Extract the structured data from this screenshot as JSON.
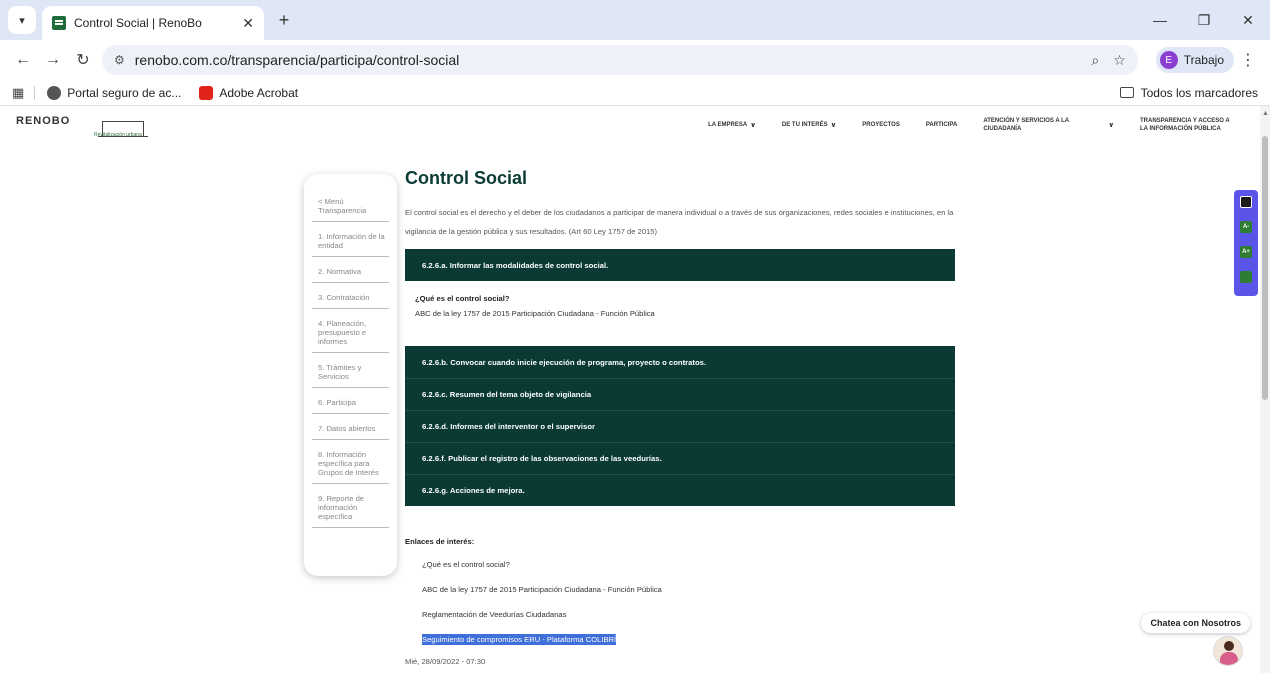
{
  "browser": {
    "tab_title": "Control Social | RenoBo",
    "tab_close": "✕",
    "new_tab": "+",
    "url": "renobo.com.co/transparencia/participa/control-social",
    "profile_initial": "E",
    "profile_name": "Trabajo",
    "bookmarks": [
      {
        "label": "Portal seguro de ac..."
      },
      {
        "label": "Adobe Acrobat"
      }
    ],
    "all_bookmarks": "Todos los marcadores"
  },
  "site": {
    "logo_text": "RENOBO",
    "logo_sub": "Revitalización urbana",
    "nav": [
      {
        "label": "LA EMPRESA",
        "chevron": "∨"
      },
      {
        "label": "DE TU INTERÉS",
        "chevron": "∨"
      },
      {
        "label": "PROYECTOS",
        "chevron": ""
      },
      {
        "label": "PARTICIPA",
        "chevron": ""
      },
      {
        "label": "ATENCIÓN Y SERVICIOS A LA CIUDADANÍA",
        "chevron": "∨"
      },
      {
        "label": "TRANSPARENCIA Y ACCESO A LA INFORMACIÓN PÚBLICA",
        "chevron": ""
      }
    ]
  },
  "sidemenu": [
    "< Menú Transparencia",
    "1. Información de la entidad",
    "2. Normativa",
    "3. Contratación",
    "4. Planeación, presupuesto e informes",
    "5. Trámites y Servicios",
    "6. Participa",
    "7. Datos abiertos",
    "8. Información específica para Grupos de Interés",
    "9. Reporte de información específica"
  ],
  "content": {
    "title": "Control Social",
    "lead": "El control social es el derecho y el deber de los ciudadanos a participar de manera individual o a través de sus organizaciones, redes sociales e instituciones, en la vigilancia de la gestión pública y sus resultados. (Art 60 Ley 1757 de 2015)",
    "accordion_first": "6.2.6.a. Informar las modalidades de control social.",
    "accordion_first_q": "¿Qué es el control social?",
    "accordion_first_link": "ABC de la ley 1757 de 2015 Participación Ciudadana - Función Pública",
    "accordion": [
      "6.2.6.b. Convocar cuando inicie ejecución de programa, proyecto o contratos.",
      "6.2.6.c. Resumen del tema objeto de vigilancia",
      "6.2.6.d. Informes del interventor o el supervisor",
      "6.2.6.f. Publicar el registro de las observaciones de las veedurías.",
      "6.2.6.g. Acciones de mejora."
    ],
    "enlaces_title": "Enlaces de interés:",
    "enlaces": [
      "¿Qué es el control social?",
      "ABC de la ley 1757 de 2015 Participación Ciudadana - Función Pública",
      "Reglamentación de Veedurías Ciudadanas",
      "Seguimiento de compromisos ERU - Plataforma COLIBRÍ"
    ],
    "date": "Mié, 28/09/2022 - 07:30"
  },
  "a11y": [
    "",
    "A-",
    "A+",
    ""
  ],
  "chat": {
    "label": "Chatea con Nosotros"
  },
  "colors": {
    "accent_dark": "#0a3a33",
    "a11y_bar": "#5a55e8",
    "selection": "#3f6fd9"
  }
}
